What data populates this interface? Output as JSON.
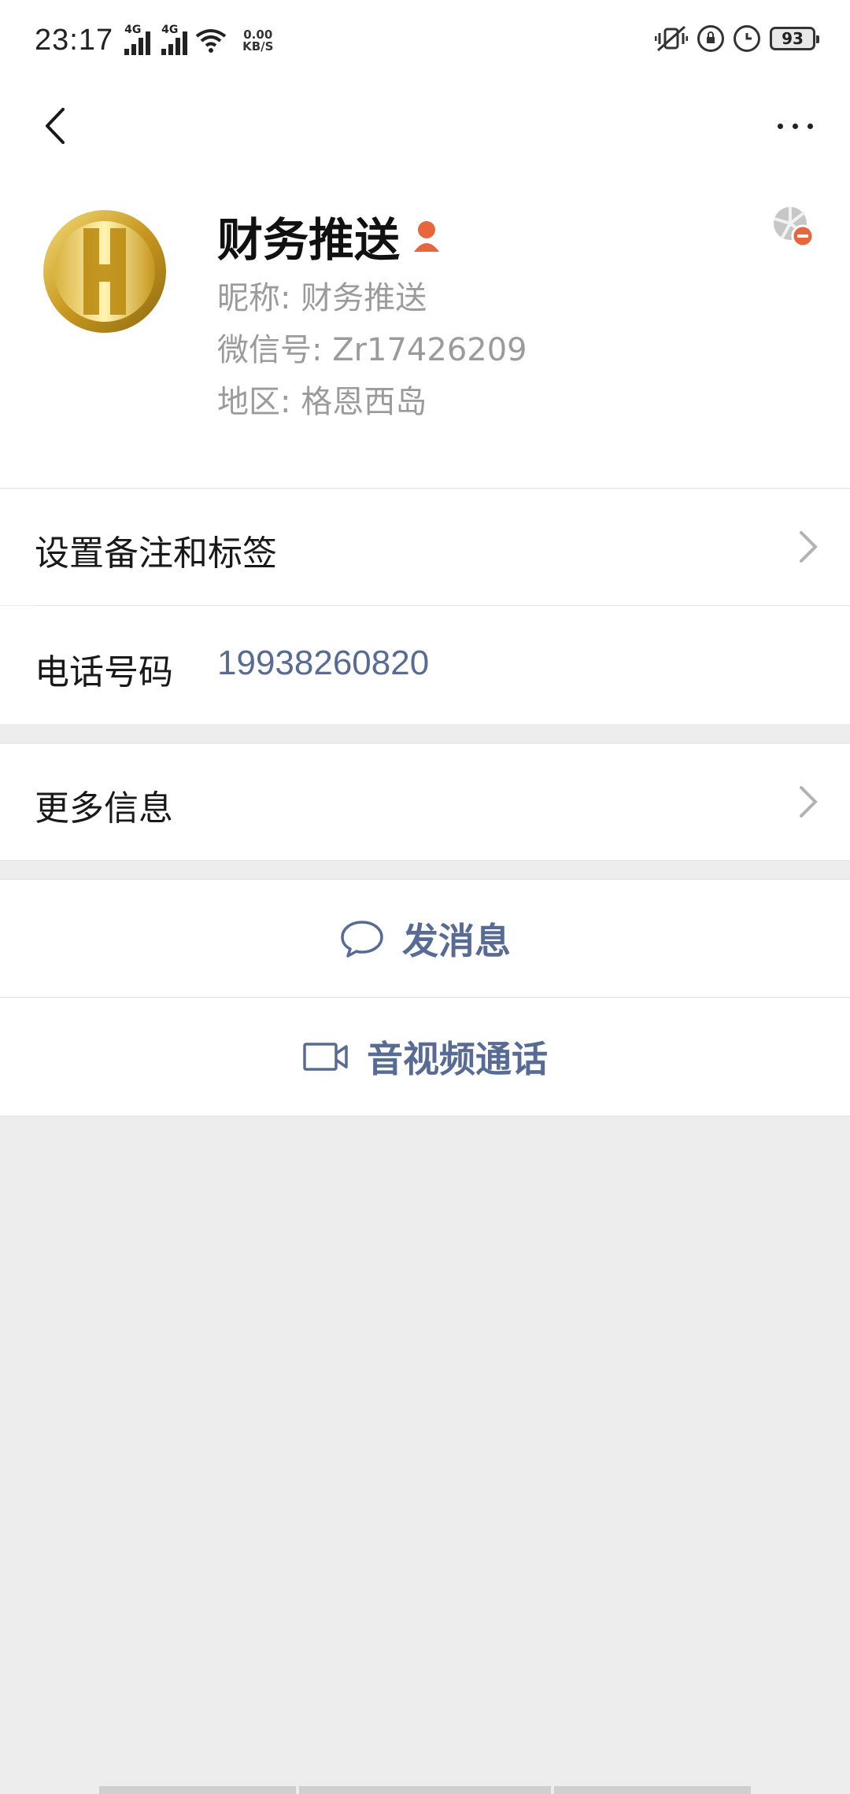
{
  "status_bar": {
    "time": "23:17",
    "sim1_type": "4G",
    "sim2_type": "4G",
    "net_speed_value": "0.00",
    "net_speed_unit": "KB/S",
    "battery": "93"
  },
  "profile": {
    "display_name": "财务推送",
    "nickname_line": "昵称: 财务推送",
    "wechat_id_line": "微信号: Zr17426209",
    "region_line": "地区: 格恩西岛"
  },
  "rows": {
    "remark_tags": "设置备注和标签",
    "phone_label": "电话号码",
    "phone_value": "19938260820",
    "more_info": "更多信息"
  },
  "actions": {
    "send_message": "发消息",
    "video_call": "音视频通话"
  },
  "colors": {
    "accent_blue": "#576b95",
    "gold": "#c9a227",
    "badge_orange": "#e8663d"
  },
  "icons": {
    "back": "back-arrow-icon",
    "more": "more-dots-icon",
    "gender": "female-icon",
    "privacy": "blocked-moments-icon",
    "chevron": "chevron-right-icon",
    "message": "chat-bubble-icon",
    "video": "video-camera-icon"
  }
}
